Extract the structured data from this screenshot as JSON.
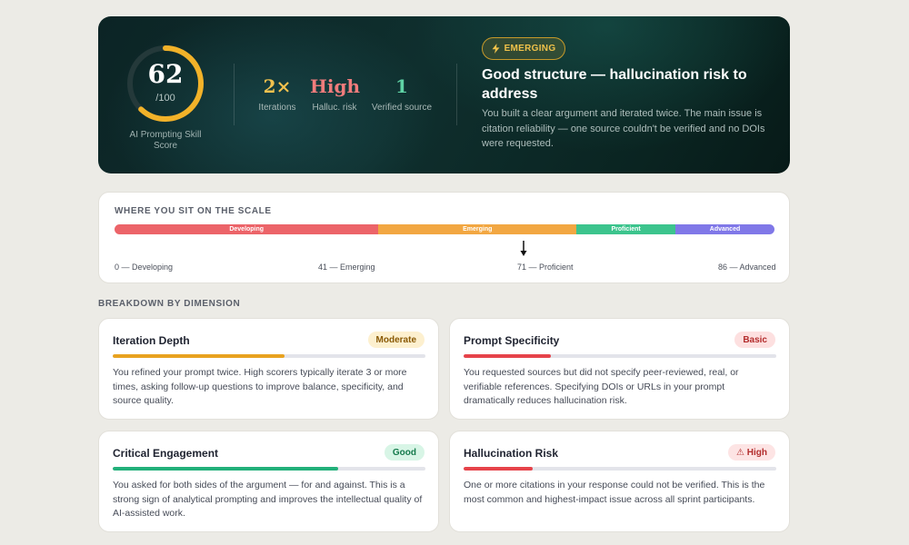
{
  "hero": {
    "score": "62",
    "score_denominator": "/100",
    "score_fraction": 0.62,
    "score_label": "AI Prompting Skill Score",
    "stats": [
      {
        "value": "2×",
        "label": "Iterations",
        "color": "#f2c14e"
      },
      {
        "value": "High",
        "label": "Halluc. risk",
        "color": "#f07c7c"
      },
      {
        "value": "1",
        "label": "Verified source",
        "color": "#5fd3a6"
      }
    ],
    "badge_icon": "lightning-icon",
    "badge_label": "EMERGING",
    "title": "Good structure — hallucination risk to address",
    "description": "You built a clear argument and iterated twice. The main issue is citation reliability — one source couldn't be verified and no DOIs were requested."
  },
  "scale": {
    "title": "WHERE YOU SIT ON THE SCALE",
    "segments": [
      {
        "label": "Developing",
        "color": "#ec6469",
        "share": 0.4
      },
      {
        "label": "Emerging",
        "color": "#f2a742",
        "share": 0.3
      },
      {
        "label": "Proficient",
        "color": "#3cc48d",
        "share": 0.15
      },
      {
        "label": "Advanced",
        "color": "#8078e8",
        "share": 0.15
      }
    ],
    "marker_value": 62,
    "marker_icon": "arrow-down-icon",
    "ticks": [
      "0 — Developing",
      "41 — Emerging",
      "71 — Proficient",
      "86 — Advanced"
    ]
  },
  "breakdown": {
    "title": "BREAKDOWN BY DIMENSION",
    "dimensions": [
      {
        "name": "Iteration Depth",
        "badge": "Moderate",
        "badge_bg": "#fdf0cf",
        "badge_fg": "#8a5a06",
        "bar_color": "#e8a21f",
        "level": 0.55,
        "description": "You refined your prompt twice. High scorers typically iterate 3 or more times, asking follow-up questions to improve balance, specificity, and source quality."
      },
      {
        "name": "Prompt Specificity",
        "badge": "Basic",
        "badge_bg": "#fde0e0",
        "badge_fg": "#b32d2d",
        "bar_color": "#e6434a",
        "level": 0.28,
        "description": "You requested sources but did not specify peer-reviewed, real, or verifiable references. Specifying DOIs or URLs in your prompt dramatically reduces hallucination risk."
      },
      {
        "name": "Critical Engagement",
        "badge": "Good",
        "badge_bg": "#d8f5e6",
        "badge_fg": "#157a4c",
        "bar_color": "#22b07a",
        "level": 0.72,
        "description": "You asked for both sides of the argument — for and against. This is a strong sign of analytical prompting and improves the intellectual quality of AI-assisted work."
      },
      {
        "name": "Hallucination Risk",
        "badge": "⚠ High",
        "badge_bg": "#fde4e4",
        "badge_fg": "#b32d2d",
        "bar_color": "#e6434a",
        "level": 0.22,
        "description": "One or more citations in your response could not be verified. This is the most common and highest-impact issue across all sprint participants."
      }
    ]
  }
}
